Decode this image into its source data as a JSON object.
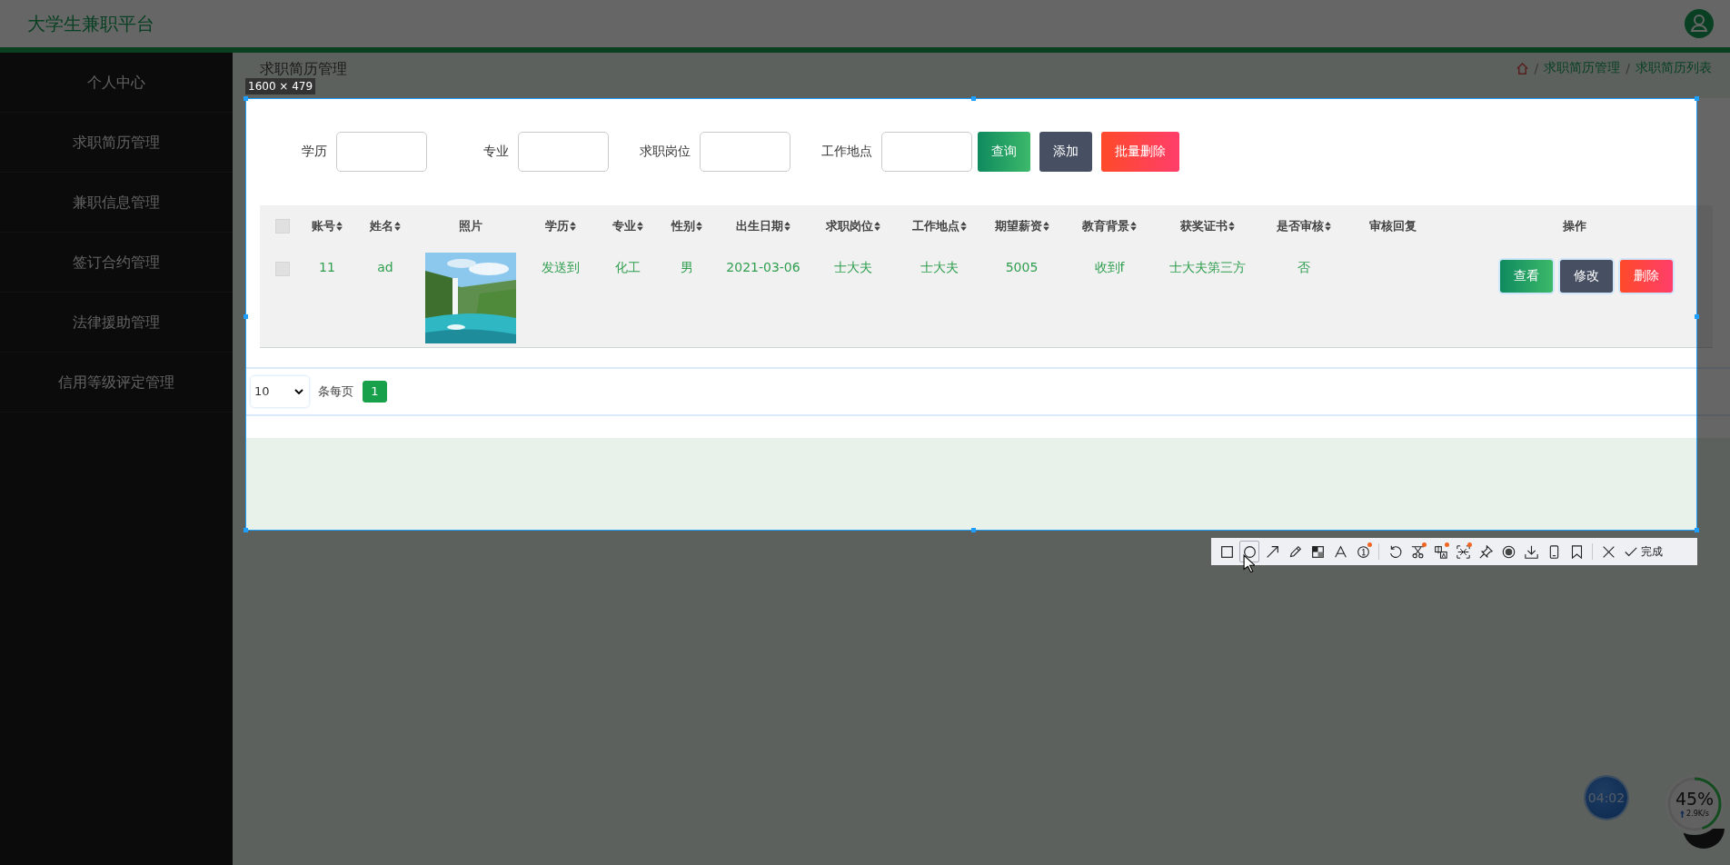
{
  "app": {
    "title": "大学生兼职平台"
  },
  "sidebar": {
    "items": [
      {
        "label": "个人中心"
      },
      {
        "label": "求职简历管理"
      },
      {
        "label": "兼职信息管理"
      },
      {
        "label": "签订合约管理"
      },
      {
        "label": "法律援助管理"
      },
      {
        "label": "信用等级评定管理"
      }
    ]
  },
  "page_header": {
    "title": "求职简历管理",
    "separator": "/",
    "breadcrumb": [
      "求职简历管理",
      "求职简历列表"
    ]
  },
  "filters": [
    {
      "label": "学历"
    },
    {
      "label": "专业"
    },
    {
      "label": "求职岗位"
    },
    {
      "label": "工作地点"
    }
  ],
  "filter_buttons": [
    {
      "label": "查询",
      "kind": "search"
    },
    {
      "label": "添加",
      "kind": "add"
    },
    {
      "label": "批量删除",
      "kind": "delete"
    }
  ],
  "table": {
    "columns": [
      {
        "kind": "checkbox",
        "checked": false
      },
      {
        "kind": "text",
        "label": "账号",
        "sortable": true
      },
      {
        "kind": "text",
        "label": "姓名",
        "sortable": true
      },
      {
        "kind": "text",
        "label": "照片",
        "sortable": false
      },
      {
        "kind": "text",
        "label": "学历",
        "sortable": true
      },
      {
        "kind": "text",
        "label": "专业",
        "sortable": true
      },
      {
        "kind": "text",
        "label": "性别",
        "sortable": true
      },
      {
        "kind": "text",
        "label": "出生日期",
        "sortable": true
      },
      {
        "kind": "text",
        "label": "求职岗位",
        "sortable": true
      },
      {
        "kind": "text",
        "label": "工作地点",
        "sortable": true
      },
      {
        "kind": "text",
        "label": "期望薪资",
        "sortable": true
      },
      {
        "kind": "text",
        "label": "教育背景",
        "sortable": true
      },
      {
        "kind": "text",
        "label": "获奖证书",
        "sortable": true
      },
      {
        "kind": "text",
        "label": "是否审核",
        "sortable": true
      },
      {
        "kind": "text",
        "label": "审核回复",
        "sortable": false
      },
      {
        "kind": "text",
        "label": "操作",
        "sortable": false
      }
    ],
    "rows": [
      {
        "checked": false,
        "account": "11",
        "name": "ad",
        "photo": {
          "kind": "picture"
        },
        "education": "发送到",
        "major": "化工",
        "gender": "男",
        "birth_date": "2021-03-06",
        "position": "士大夫",
        "location": "士大夫",
        "salary": "5005",
        "edu_background": "收到f",
        "awards": "士大夫第三方",
        "reviewed": "否",
        "actions": [
          {
            "label": "查看",
            "kind": "view"
          },
          {
            "label": "修改",
            "kind": "edit"
          },
          {
            "label": "删除",
            "kind": "delete"
          }
        ]
      }
    ]
  },
  "pagination": {
    "page_size": "10",
    "per_page_label": "条每页",
    "pages": [
      {
        "label": "1",
        "selected": true
      }
    ]
  },
  "capture": {
    "size_label": "1600 × 479",
    "done_label": "完成",
    "tool_groups": [
      [
        {
          "kind": "rect",
          "selected": false,
          "dot": false
        },
        {
          "kind": "circle",
          "selected": true,
          "dot": false
        },
        {
          "kind": "arrow",
          "selected": false,
          "dot": false
        },
        {
          "kind": "pencil",
          "selected": false,
          "dot": false
        },
        {
          "kind": "mosaic",
          "selected": false,
          "dot": false
        },
        {
          "kind": "text",
          "selected": false,
          "dot": false
        },
        {
          "kind": "number",
          "selected": false,
          "dot": true
        }
      ],
      [
        {
          "kind": "undo",
          "selected": false,
          "dot": false
        },
        {
          "kind": "scissors",
          "selected": false,
          "dot": true
        },
        {
          "kind": "translate",
          "selected": false,
          "dot": true
        },
        {
          "kind": "ocr",
          "selected": false,
          "dot": true
        },
        {
          "kind": "pin",
          "selected": false,
          "dot": false
        },
        {
          "kind": "record",
          "selected": false,
          "dot": false
        },
        {
          "kind": "download",
          "selected": false,
          "dot": false
        },
        {
          "kind": "phone",
          "selected": false,
          "dot": false
        },
        {
          "kind": "bookmark",
          "selected": false,
          "dot": false
        }
      ],
      [
        {
          "kind": "close",
          "selected": false,
          "dot": false
        }
      ]
    ]
  },
  "widgets": {
    "timer": "04:02",
    "meter": {
      "reading": "45%",
      "level": 0.45,
      "speed": "2.9K/s"
    }
  }
}
